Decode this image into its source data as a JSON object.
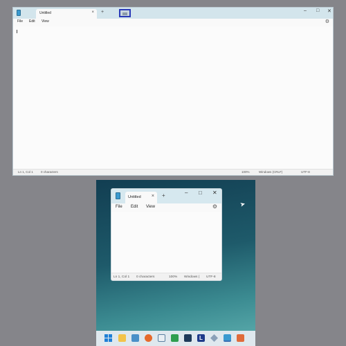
{
  "top_window": {
    "tab_title": "Untitled",
    "tab_close": "×",
    "new_tab": "+",
    "controls": {
      "minimize": "–",
      "maximize": "□",
      "close": "✕"
    },
    "menu": [
      "File",
      "Edit",
      "View"
    ],
    "settings_icon": "gear-icon",
    "status": {
      "position": "Ln 1, Col 1",
      "characters": "0 characters",
      "zoom": "100%",
      "line_ending": "Windows (CRLF)",
      "encoding": "UTF-8"
    }
  },
  "bottom_window": {
    "tab_title": "Untitled",
    "tab_close": "×",
    "new_tab": "+",
    "controls": {
      "minimize": "–",
      "maximize": "□",
      "close": "✕"
    },
    "menu": [
      "File",
      "Edit",
      "View"
    ],
    "settings_icon": "gear-icon",
    "status": {
      "position": "Ln 1, Col 1",
      "characters": "0 characters",
      "zoom": "100%",
      "line_ending": "Windows (",
      "encoding": "UTF-8"
    }
  },
  "taskbar": {
    "icons": [
      "windows-start-icon",
      "file-explorer-icon",
      "photos-icon",
      "firefox-icon",
      "document-icon",
      "spreadsheet-icon",
      "terminal-icon",
      "l-app-icon",
      "settings-app-icon",
      "notepad-icon",
      "snipping-tool-icon"
    ],
    "l_app_label": "L",
    "colors": {
      "accent": "#3b6fb5",
      "highlight_border": "#2b3bb8"
    }
  }
}
